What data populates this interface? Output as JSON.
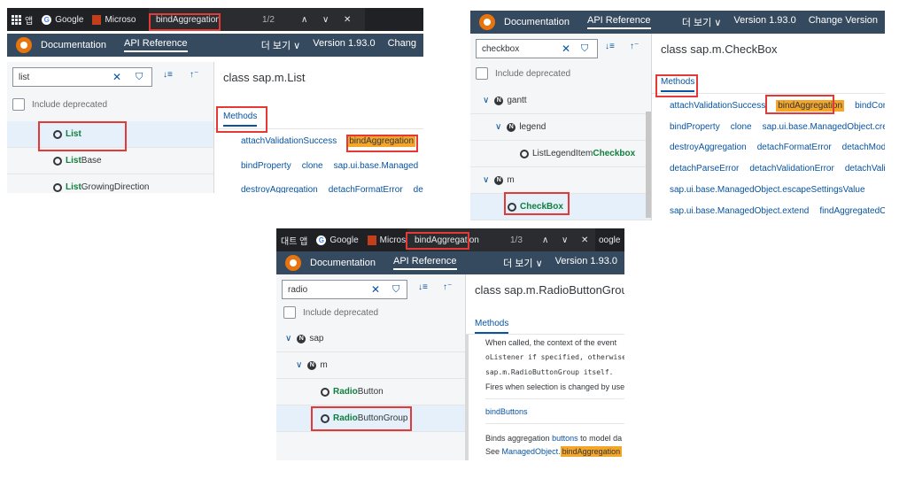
{
  "panel1": {
    "chrome": {
      "apps_label": "앱",
      "google_label": "Google",
      "ms_label": "Microso",
      "find_query": "bindAggregation",
      "find_count": "1/2",
      "up": "∧",
      "down": "∨",
      "close": "✕"
    },
    "shell": {
      "documentation": "Documentation",
      "api_reference": "API Reference",
      "more": "더 보기 ∨",
      "version": "Version 1.93.0",
      "change": "Chang"
    },
    "search": {
      "value": "list",
      "clear": "✕",
      "filter": "⛉",
      "sort": "↓≡",
      "collapse": "↑⁻"
    },
    "include_deprecated": "Include deprecated",
    "tree": [
      {
        "match": "List",
        "rest": "",
        "selected": true
      },
      {
        "match": "List",
        "rest": "Base",
        "selected": false
      },
      {
        "match": "List",
        "rest": "GrowingDirection",
        "selected": false
      }
    ],
    "class_title": "class sap.m.List",
    "methods_tab": "Methods",
    "method_rows": [
      [
        "attachValidationSuccess",
        "bindAggregation"
      ],
      [
        "bindProperty",
        "clone",
        "sap.ui.base.Managed"
      ],
      [
        "destroyAggregation",
        "detachFormatError",
        "de"
      ]
    ]
  },
  "panel2": {
    "shell": {
      "documentation": "Documentation",
      "api_reference": "API Reference",
      "more": "더 보기 ∨",
      "version": "Version 1.93.0",
      "change": "Change Version"
    },
    "search": {
      "value": "checkbox",
      "clear": "✕",
      "filter": "⛉",
      "sort": "↓≡",
      "collapse": "↑⁻"
    },
    "include_deprecated": "Include deprecated",
    "tree": [
      {
        "label": "gantt",
        "type": "ns",
        "indent": 0
      },
      {
        "label": "legend",
        "type": "ns",
        "indent": 1
      },
      {
        "prefix": "ListLegendItem",
        "match": "Checkbox",
        "type": "class",
        "indent": 3
      },
      {
        "label": "m",
        "type": "ns",
        "indent": 0
      },
      {
        "match": "CheckBox",
        "type": "class",
        "indent": 1,
        "selected": true
      }
    ],
    "class_title": "class sap.m.CheckBox",
    "methods_tab": "Methods",
    "method_rows": [
      [
        "attachValidationSuccess",
        "bindAggregation",
        "bindContext"
      ],
      [
        "bindProperty",
        "clone",
        "sap.ui.base.ManagedObject.create"
      ],
      [
        "destroyAggregation",
        "detachFormatError",
        "detachModelCo"
      ],
      [
        "detachParseError",
        "detachValidationError",
        "detachValidatio"
      ],
      [
        "sap.ui.base.ManagedObject.escapeSettingsValue"
      ],
      [
        "sap.ui.base.ManagedObject.extend",
        "findAggregatedObject"
      ]
    ]
  },
  "panel3": {
    "chrome": {
      "apps_label": "대트 앱",
      "google_label": "Google",
      "ms_label": "Microso",
      "find_query": "bindAggregation",
      "find_count": "1/3",
      "up": "∧",
      "down": "∨",
      "close": "✕",
      "trailing": "oogle"
    },
    "shell": {
      "documentation": "Documentation",
      "api_reference": "API Reference",
      "more": "더 보기 ∨",
      "version": "Version 1.93.0"
    },
    "search": {
      "value": "radio",
      "clear": "✕",
      "filter": "⛉",
      "sort": "↓≡",
      "collapse": "↑⁻"
    },
    "include_deprecated": "Include deprecated",
    "tree": [
      {
        "label": "sap",
        "type": "ns",
        "indent": 0
      },
      {
        "label": "m",
        "type": "ns",
        "indent": 1
      },
      {
        "match": "Radio",
        "rest": "Button",
        "type": "class",
        "indent": 2
      },
      {
        "match": "Radio",
        "rest": "ButtonGroup",
        "type": "class",
        "indent": 2,
        "selected": true
      }
    ],
    "class_title": "class sap.m.RadioButtonGroup",
    "methods_tab": "Methods",
    "doc": {
      "line1": "When called, the context of the event",
      "line2": "oListener if specified, otherwise it wi",
      "line3": "sap.m.RadioButtonGroup itself.",
      "line4": "Fires when selection is changed by use",
      "method_name": "bindButtons",
      "line5_prefix": "Binds aggregation",
      "line5_link": "buttons",
      "line5_suffix": "to model da",
      "line6_prefix": "See",
      "line6_link": "ManagedObject.",
      "line6_match": "bindAggregation"
    }
  },
  "colors": {
    "shell": "#354a5f",
    "link": "#0854a0",
    "find_highlight": "#f4a62a",
    "annotation": "#e53935",
    "match": "#107e3e"
  }
}
